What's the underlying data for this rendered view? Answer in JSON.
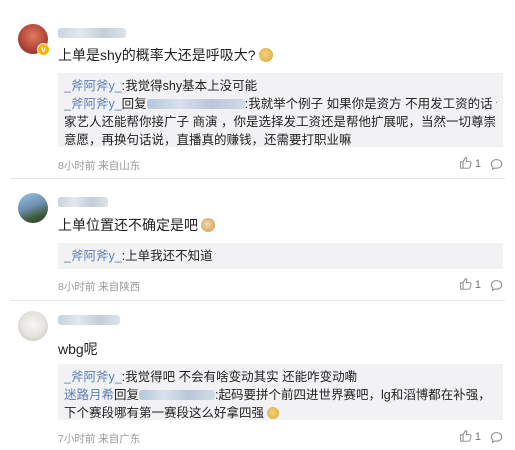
{
  "comments": [
    {
      "text": "上单是shy的概率大还是呼吸大?",
      "replies": [
        {
          "author": "_斧阿斧y_",
          "sep": ":",
          "text": "我觉得shy基本上没可能"
        },
        {
          "author": "_斧阿斧y_",
          "reply_word": "回复",
          "sep": ":",
          "text": "我就举个例子 如果你是资方 不用发工资的话 你",
          "cont1": "家艺人还能帮你接广子 商演 ，你是选择发工资还是帮他扩展呢，当然一切尊崇自身",
          "cont2": "意愿，再换句话说，直播真的赚钱，还需要打职业嘛"
        }
      ],
      "time": "8小时前 来自山东",
      "likes": "1"
    },
    {
      "text": "上单位置还不确定是吧",
      "replies": [
        {
          "author": "_斧阿斧y_",
          "sep": ":",
          "text": "上单我还不知道"
        }
      ],
      "time": "8小时前 来自陕西",
      "likes": "1"
    },
    {
      "text": "wbg呢",
      "replies": [
        {
          "author": "_斧阿斧y_",
          "sep": ":",
          "text": "我觉得吧 不会有啥变动其实 还能咋变动嘞"
        },
        {
          "author": "迷路月希",
          "reply_word": "回复",
          "sep": ":",
          "text": "起码要拼个前四进世界赛吧，lg和滔博都在补强，",
          "cont1": "下个赛段哪有第一赛段这么好拿四强"
        }
      ],
      "time": "7小时前 来自广东",
      "likes": "1"
    }
  ],
  "icons": [
    "like-icon",
    "comment-icon"
  ],
  "colors": {
    "link": "#5b7fb8",
    "reply_bg": "#f2f2f5",
    "meta": "#999999"
  }
}
